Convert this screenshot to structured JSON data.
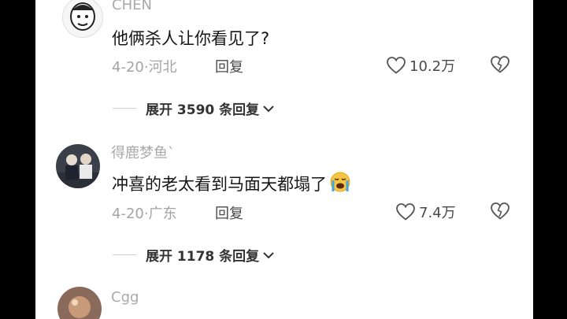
{
  "comments": [
    {
      "username": "CHEN",
      "content": "他俩杀人让你看见了?",
      "date": "4-20",
      "location": "河北",
      "reply_label": "回复",
      "likes": "10.2万",
      "expand_label": "展开 3590 条回复"
    },
    {
      "username": "得鹿梦鱼`",
      "content": "冲喜的老太看到马面天都塌了",
      "emoji": "loudly-crying-face",
      "date": "4-20",
      "location": "广东",
      "reply_label": "回复",
      "likes": "7.4万",
      "expand_label": "展开 1178 条回复"
    },
    {
      "username": "Cgg"
    }
  ],
  "separator": "·"
}
